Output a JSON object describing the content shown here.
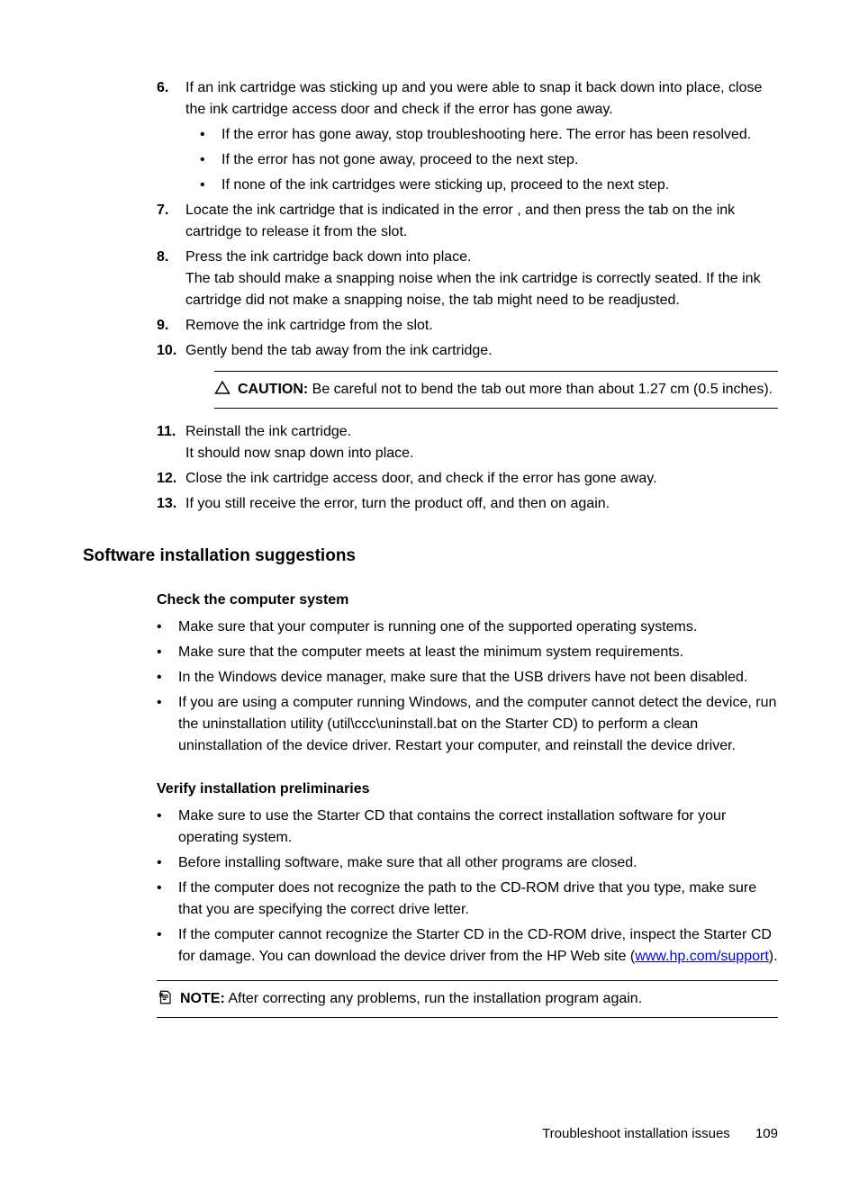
{
  "steps": {
    "s6": {
      "num": "6.",
      "text": "If an ink cartridge was sticking up and you were able to snap it back down into place, close the ink cartridge access door and check if the error has gone away.",
      "b1": "If the error has gone away, stop troubleshooting here. The error has been resolved.",
      "b2": "If the error has not gone away, proceed to the next step.",
      "b3": "If none of the ink cartridges were sticking up, proceed to the next step."
    },
    "s7": {
      "num": "7.",
      "text": "Locate the ink cartridge that is indicated in the error , and then press the tab on the ink cartridge to release it from the slot."
    },
    "s8": {
      "num": "8.",
      "text": "Press the ink cartridge back down into place.",
      "text2": "The tab should make a snapping noise when the ink cartridge is correctly seated. If the ink cartridge did not make a snapping noise, the tab might need to be readjusted."
    },
    "s9": {
      "num": "9.",
      "text": "Remove the ink cartridge from the slot."
    },
    "s10": {
      "num": "10.",
      "text": "Gently bend the tab away from the ink cartridge."
    },
    "caution": {
      "label": "CAUTION:",
      "text": " Be careful not to bend the tab out more than about 1.27 cm (0.5 inches)."
    },
    "s11": {
      "num": "11.",
      "text": "Reinstall the ink cartridge.",
      "text2": "It should now snap down into place."
    },
    "s12": {
      "num": "12.",
      "text": "Close the ink cartridge access door, and check if the error has gone away."
    },
    "s13": {
      "num": "13.",
      "text": "If you still receive the error, turn the product off, and then on again."
    }
  },
  "heading": "Software installation suggestions",
  "check": {
    "head": "Check the computer system",
    "b1": "Make sure that your computer is running one of the supported operating systems.",
    "b2": "Make sure that the computer meets at least the minimum system requirements.",
    "b3": "In the Windows device manager, make sure that the USB drivers have not been disabled.",
    "b4": "If you are using a computer running Windows, and the computer cannot detect the device, run the uninstallation utility (util\\ccc\\uninstall.bat on the Starter CD) to perform a clean uninstallation of the device driver. Restart your computer, and reinstall the device driver."
  },
  "verify": {
    "head": "Verify installation preliminaries",
    "b1": "Make sure to use the Starter CD that contains the correct installation software for your operating system.",
    "b2": "Before installing software, make sure that all other programs are closed.",
    "b3": "If the computer does not recognize the path to the CD-ROM drive that you type, make sure that you are specifying the correct drive letter.",
    "b4a": "If the computer cannot recognize the Starter CD in the CD-ROM drive, inspect the Starter CD for damage. You can download the device driver from the HP Web site (",
    "link": "www.hp.com/support",
    "b4b": ")."
  },
  "note": {
    "label": "NOTE:",
    "text": " After correcting any problems, run the installation program again."
  },
  "footer": {
    "section": "Troubleshoot installation issues",
    "page": "109"
  }
}
